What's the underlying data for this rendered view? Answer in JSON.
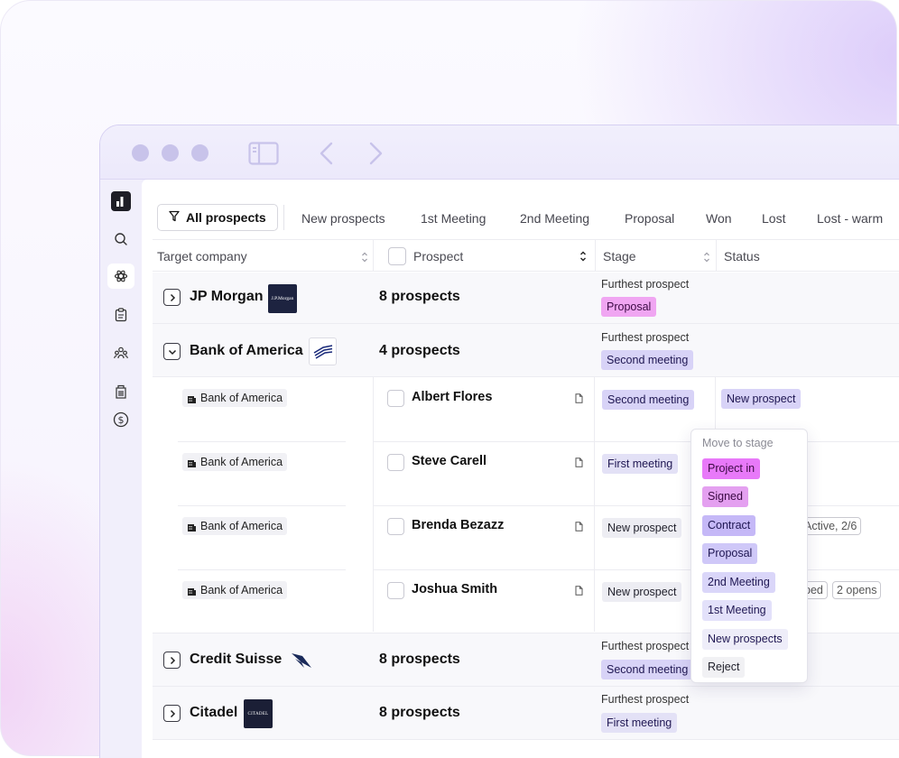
{
  "tabs": {
    "all_label": "All prospects",
    "items": [
      "New prospects",
      "1st Meeting",
      "2nd Meeting",
      "Proposal",
      "Won",
      "Lost",
      "Lost - warm"
    ]
  },
  "columns": {
    "target_company": "Target company",
    "prospect": "Prospect",
    "stage": "Stage",
    "status": "Status"
  },
  "groups": [
    {
      "company": "JP Morgan",
      "count": "8 prospects",
      "furthest_label": "Furthest prospect",
      "stage": "Proposal",
      "expanded": false
    },
    {
      "company": "Bank of America",
      "count": "4 prospects",
      "furthest_label": "Furthest prospect",
      "stage": "Second meeting",
      "expanded": true
    },
    {
      "company": "Credit Suisse",
      "count": "8 prospects",
      "furthest_label": "Furthest prospect",
      "stage": "Second meeting",
      "expanded": false
    },
    {
      "company": "Citadel",
      "count": "8 prospects",
      "furthest_label": "Furthest prospect",
      "stage": "First meeting",
      "expanded": false
    }
  ],
  "logos": {
    "jpmorgan_text": "J.P.Morgan",
    "citadel_text": "CITADEL"
  },
  "rows": [
    {
      "company": "Bank of America",
      "name": "Albert Flores",
      "stage": "Second meeting",
      "status": "New prospect"
    },
    {
      "company": "Bank of America",
      "name": "Steve Carell",
      "stage": "First meeting",
      "status": ""
    },
    {
      "company": "Bank of America",
      "name": "Brenda Bezazz",
      "stage": "New prospect",
      "status": "Active, 2/6"
    },
    {
      "company": "Bank of America",
      "name": "Joshua Smith",
      "stage": "New prospect",
      "status": "ped",
      "status2": "2 opens"
    }
  ],
  "menu": {
    "title": "Move to stage",
    "items": [
      {
        "label": "Project in",
        "bg": "#e879f9",
        "fg": "#3b0a44"
      },
      {
        "label": "Signed",
        "bg": "#e4a0f0",
        "fg": "#3b0a44"
      },
      {
        "label": "Contract",
        "bg": "#c5b8f7",
        "fg": "#1f1752"
      },
      {
        "label": "Proposal",
        "bg": "#cfc8f8",
        "fg": "#1f1752"
      },
      {
        "label": "2nd Meeting",
        "bg": "#dad6f9",
        "fg": "#1f1752"
      },
      {
        "label": "1st Meeting",
        "bg": "#e3e1fa",
        "fg": "#1f1752"
      },
      {
        "label": "New prospects",
        "bg": "#eeedf9",
        "fg": "#1f1752"
      },
      {
        "label": "Reject",
        "bg": "#f1f1f4",
        "fg": "#1f1f2a"
      }
    ]
  },
  "colors": {
    "proposal_chip": "#f0a6f2",
    "second_meeting_chip": "#d8d3f7",
    "first_meeting_chip": "#e3e1f6",
    "new_prospect_chip": "#ededf3"
  }
}
